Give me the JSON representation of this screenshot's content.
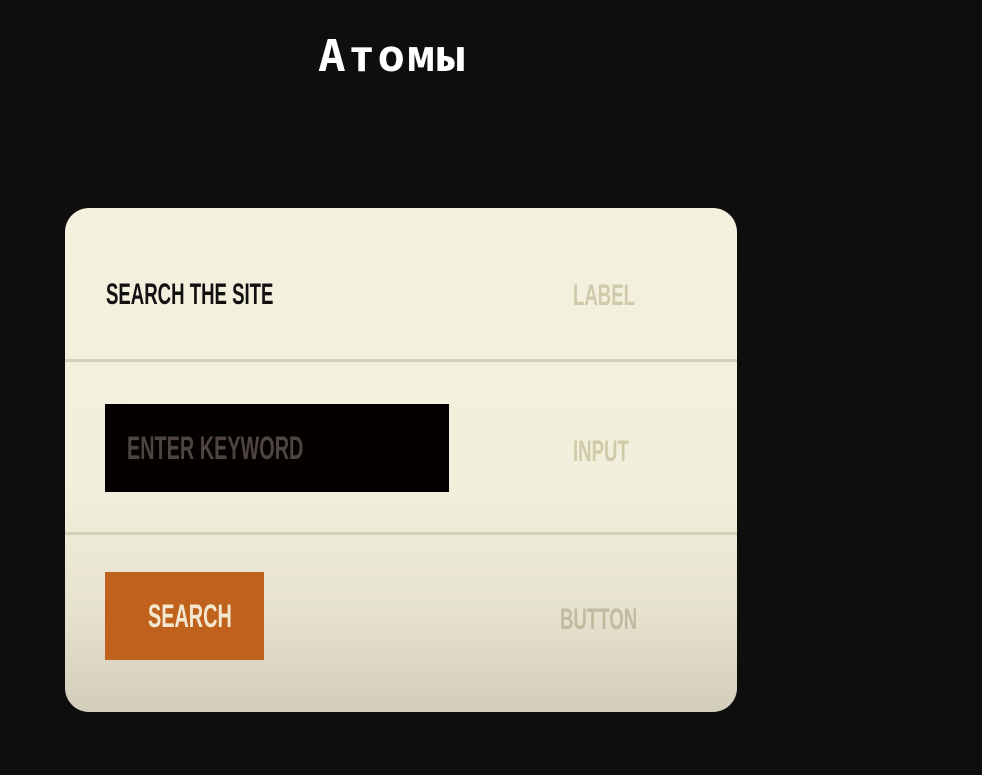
{
  "slide": {
    "title": "Атомы"
  },
  "card": {
    "label_row": {
      "text": "Search the site",
      "kind": "Label"
    },
    "input_row": {
      "placeholder": "Enter keyword",
      "kind": "Input"
    },
    "button_row": {
      "button_label": "Search",
      "kind": "Button"
    }
  },
  "colors": {
    "background": "#0e0e0e",
    "card": "#f4f1df",
    "input_bg": "#050000",
    "button_bg": "#c0621e",
    "kind_label": "#cfcbaa"
  }
}
